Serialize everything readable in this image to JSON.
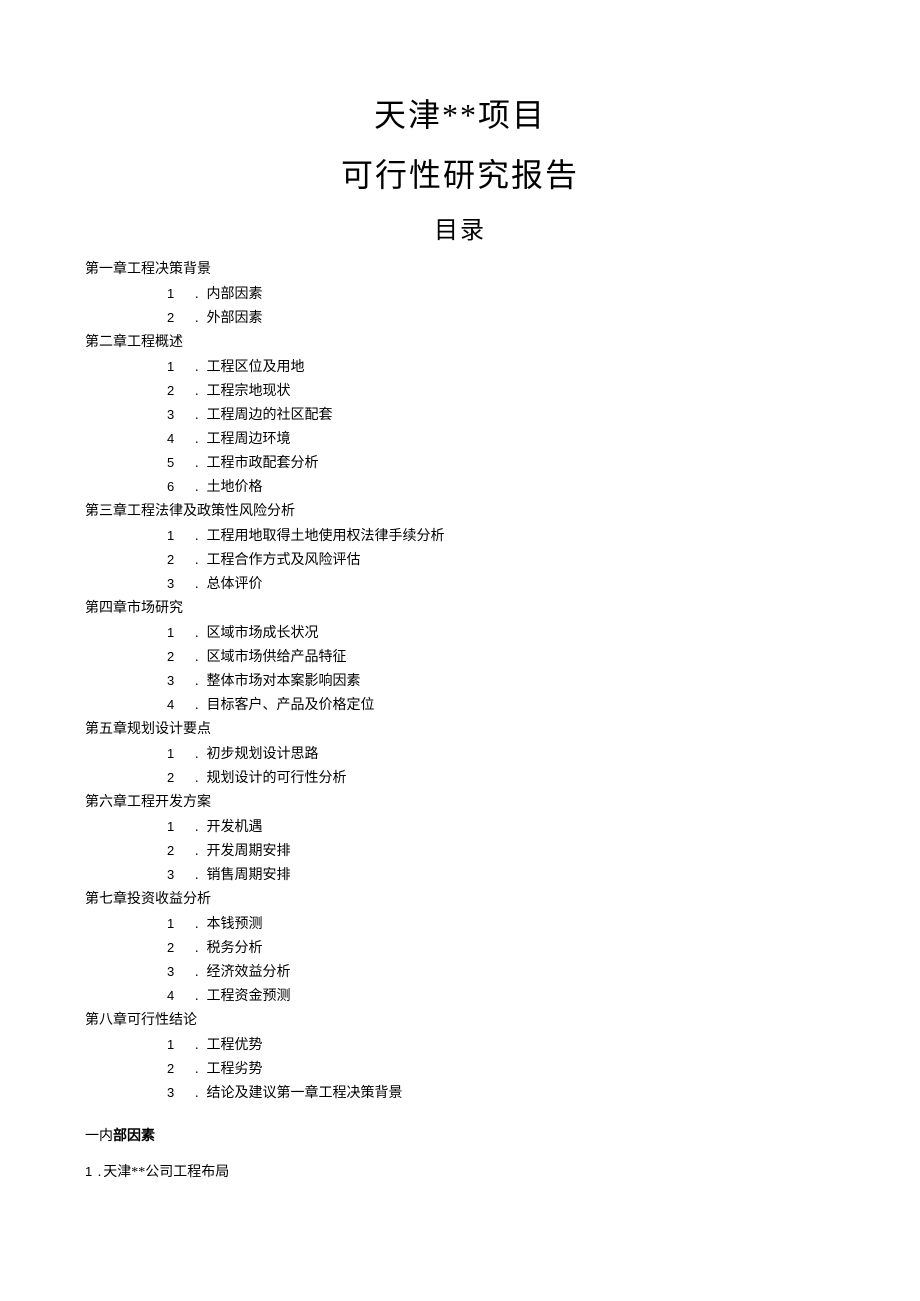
{
  "title": {
    "line1": "天津**项目",
    "line2": "可行性研究报告",
    "toc": "目录"
  },
  "chapters": [
    {
      "heading": "第一章工程决策背景",
      "items": [
        {
          "n": "1",
          "sep": ".",
          "text": "内部因素"
        },
        {
          "n": "2",
          "sep": ".",
          "text": "外部因素"
        }
      ]
    },
    {
      "heading": "第二章工程概述",
      "items": [
        {
          "n": "1",
          "sep": ".",
          "text": "工程区位及用地"
        },
        {
          "n": "2",
          "sep": ".",
          "text": "工程宗地现状"
        },
        {
          "n": "3",
          "sep": ".",
          "text": "工程周边的社区配套"
        },
        {
          "n": "4",
          "sep": ".",
          "text": "工程周边环境"
        },
        {
          "n": "5",
          "sep": ".",
          "text": "工程市政配套分析"
        },
        {
          "n": "6",
          "sep": ".",
          "text": "土地价格"
        }
      ]
    },
    {
      "heading": "第三章工程法律及政策性风险分析",
      "items": [
        {
          "n": "1",
          "sep": ".",
          "text": "工程用地取得土地使用权法律手续分析"
        },
        {
          "n": "2",
          "sep": ".",
          "text": "工程合作方式及风险评估"
        },
        {
          "n": "3",
          "sep": ".",
          "text": "总体评价"
        }
      ]
    },
    {
      "heading": "第四章市场研究",
      "items": [
        {
          "n": "1",
          "sep": ".",
          "text": "区域市场成长状况"
        },
        {
          "n": "2",
          "sep": ".",
          "text": "区域市场供给产品特征"
        },
        {
          "n": "3",
          "sep": ".",
          "text": "整体市场对本案影响因素"
        },
        {
          "n": "4",
          "sep": ".",
          "text": "目标客户、产品及价格定位"
        }
      ]
    },
    {
      "heading": "第五章规划设计要点",
      "items": [
        {
          "n": "1",
          "sep": ".",
          "text": "初步规划设计思路"
        },
        {
          "n": "2",
          "sep": ".",
          "text": "规划设计的可行性分析"
        }
      ]
    },
    {
      "heading": "第六章工程开发方案",
      "items": [
        {
          "n": "1",
          "sep": ".",
          "text": "开发机遇"
        },
        {
          "n": "2",
          "sep": ".",
          "text": "开发周期安排"
        },
        {
          "n": "3",
          "sep": ".",
          "text": "销售周期安排"
        }
      ]
    },
    {
      "heading": "第七章投资收益分析",
      "items": [
        {
          "n": "1",
          "sep": ".",
          "text": "本钱预测"
        },
        {
          "n": "2",
          "sep": ".",
          "text": "税务分析"
        },
        {
          "n": "3",
          "sep": ".",
          "text": "经济效益分析"
        },
        {
          "n": "4",
          "sep": ".",
          "text": "工程资金预测"
        }
      ]
    },
    {
      "heading": "第八章可行性结论",
      "items": [
        {
          "n": "1",
          "sep": ".",
          "text": "工程优势"
        },
        {
          "n": "2",
          "sep": ".",
          "text": "工程劣势"
        },
        {
          "n": "3",
          "sep": ".",
          "text": "结论及建议第一章工程决策背景"
        }
      ]
    }
  ],
  "section_heading": {
    "light": "一内",
    "bold": "部因素"
  },
  "final_line": {
    "n": "1",
    "sep": ".",
    "text": "天津**公司工程布局"
  }
}
